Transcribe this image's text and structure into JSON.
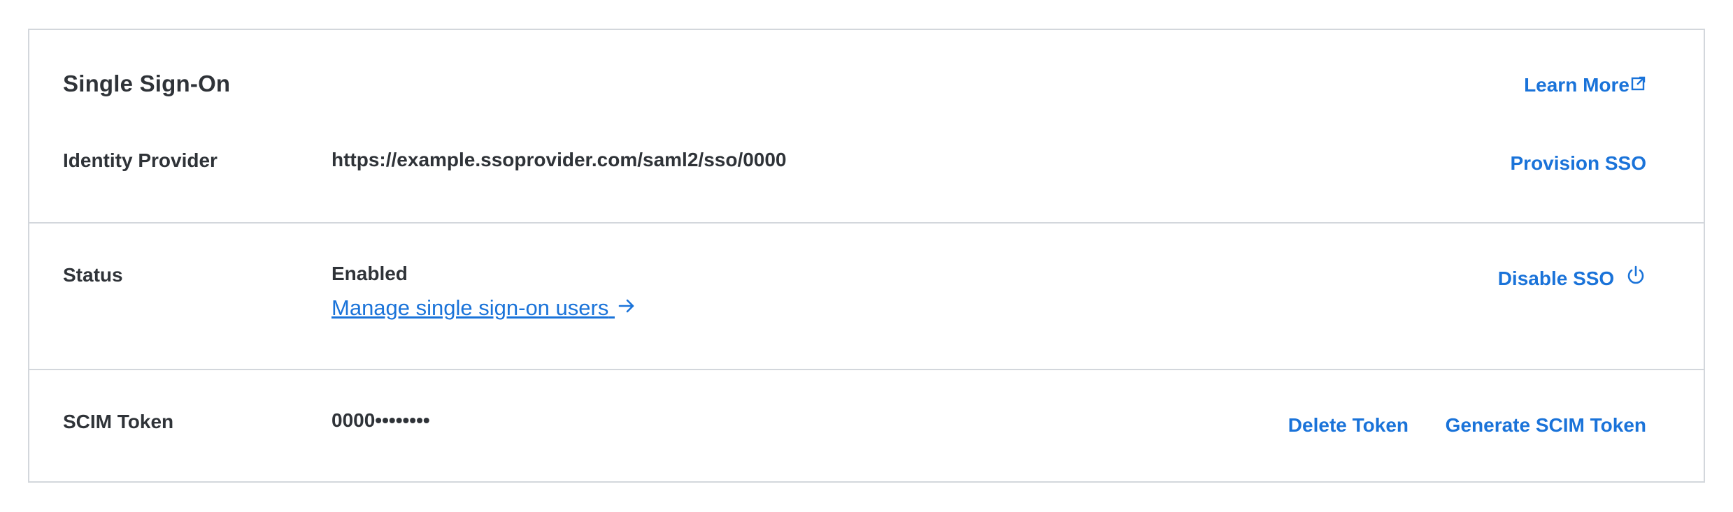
{
  "sso": {
    "title": "Single Sign-On",
    "learn_more": "Learn More",
    "identity_provider": {
      "label": "Identity Provider",
      "value": "https://example.ssoprovider.com/saml2/sso/0000",
      "action": "Provision SSO"
    },
    "status": {
      "label": "Status",
      "value": "Enabled",
      "manage_link": "Manage single sign-on users",
      "action": "Disable SSO"
    },
    "scim": {
      "label": "SCIM Token",
      "value": "0000••••••••",
      "delete": "Delete Token",
      "generate": "Generate SCIM Token"
    }
  },
  "colors": {
    "link": "#1a73d9",
    "text": "#2f3338",
    "border": "#d3d7dc"
  },
  "icons": {
    "learn_more": "external-link-icon",
    "manage": "arrow-right-icon",
    "disable": "power-icon"
  }
}
